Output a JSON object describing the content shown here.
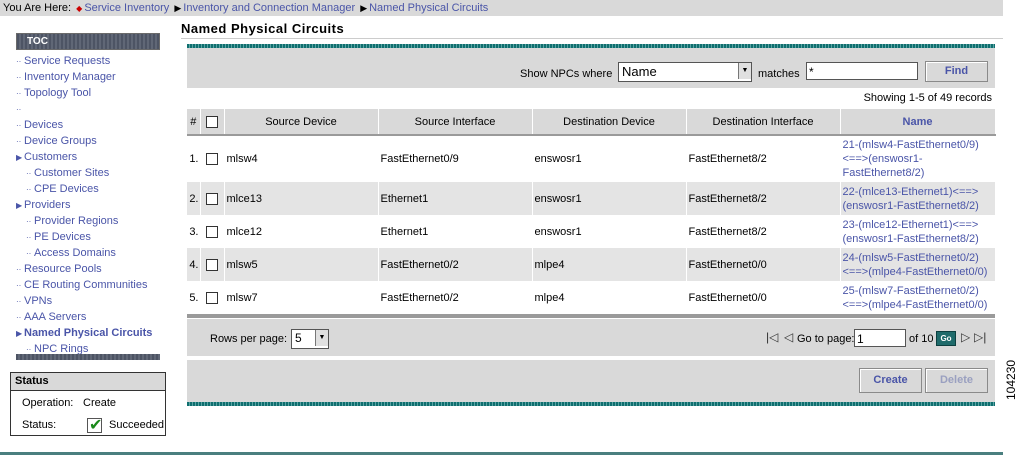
{
  "breadcrumb": {
    "prefix": "You Are Here:",
    "items": [
      "Service Inventory",
      "Inventory and Connection Manager",
      "Named Physical Circuits"
    ]
  },
  "toc": {
    "title": "TOC",
    "items": [
      {
        "label": "Service Requests",
        "sub": false
      },
      {
        "label": "Inventory Manager",
        "sub": false
      },
      {
        "label": "Topology Tool",
        "sub": false
      },
      {
        "label": "",
        "sub": false
      },
      {
        "label": "Devices",
        "sub": false
      },
      {
        "label": "Device Groups",
        "sub": false
      },
      {
        "label": "Customers",
        "sub": false
      },
      {
        "label": "Customer Sites",
        "sub": true
      },
      {
        "label": "CPE Devices",
        "sub": true
      },
      {
        "label": "Providers",
        "sub": false
      },
      {
        "label": "Provider Regions",
        "sub": true
      },
      {
        "label": "PE Devices",
        "sub": true
      },
      {
        "label": "Access Domains",
        "sub": true
      },
      {
        "label": "Resource Pools",
        "sub": false
      },
      {
        "label": "CE Routing Communities",
        "sub": false
      },
      {
        "label": "VPNs",
        "sub": false
      },
      {
        "label": "AAA Servers",
        "sub": false
      },
      {
        "label": "Named Physical Circuits",
        "sub": false
      },
      {
        "label": "NPC Rings",
        "sub": true
      }
    ]
  },
  "status": {
    "title": "Status",
    "operation_label": "Operation:",
    "operation_value": "Create",
    "status_label": "Status:",
    "status_value": "Succeeded"
  },
  "page": {
    "title": "Named Physical Circuits"
  },
  "filter": {
    "show_label": "Show NPCs where",
    "field_value": "Name",
    "matches_label": "matches",
    "match_value": "*",
    "find_label": "Find"
  },
  "records_text": "Showing 1-5 of 49 records",
  "table": {
    "headers": [
      "#",
      "",
      "Source Device",
      "Source Interface",
      "Destination Device",
      "Destination Interface",
      "Name"
    ],
    "rows": [
      {
        "num": "1.",
        "src_dev": "mlsw4",
        "src_if": "FastEthernet0/9",
        "dst_dev": "enswosr1",
        "dst_if": "FastEthernet8/2",
        "name": [
          "21-(mlsw4-FastEthernet0/9)",
          "<==>(enswosr1-",
          "FastEthernet8/2)"
        ]
      },
      {
        "num": "2.",
        "src_dev": "mlce13",
        "src_if": "Ethernet1",
        "dst_dev": "enswosr1",
        "dst_if": "FastEthernet8/2",
        "name": [
          "22-(mlce13-Ethernet1)<==>",
          "(enswosr1-FastEthernet8/2)"
        ]
      },
      {
        "num": "3.",
        "src_dev": "mlce12",
        "src_if": "Ethernet1",
        "dst_dev": "enswosr1",
        "dst_if": "FastEthernet8/2",
        "name": [
          "23-(mlce12-Ethernet1)<==>",
          "(enswosr1-FastEthernet8/2)"
        ]
      },
      {
        "num": "4.",
        "src_dev": "mlsw5",
        "src_if": "FastEthernet0/2",
        "dst_dev": "mlpe4",
        "dst_if": "FastEthernet0/0",
        "name": [
          "24-(mlsw5-FastEthernet0/2)",
          "<==>(mlpe4-FastEthernet0/0)"
        ]
      },
      {
        "num": "5.",
        "src_dev": "mlsw7",
        "src_if": "FastEthernet0/2",
        "dst_dev": "mlpe4",
        "dst_if": "FastEthernet0/0",
        "name": [
          "25-(mlsw7-FastEthernet0/2)",
          "<==>(mlpe4-FastEthernet0/0)"
        ]
      }
    ]
  },
  "pager": {
    "rows_label": "Rows per page:",
    "rows_value": "5",
    "goto_label": "Go to page:",
    "page_value": "1",
    "of_text": "of 10",
    "go_label": "Go"
  },
  "actions": {
    "create_label": "Create",
    "delete_label": "Delete"
  },
  "figure_id": "104230",
  "colors": {
    "link": "#4a55a8",
    "teal": "#0f6f6f",
    "panel": "#d9d9d9"
  }
}
